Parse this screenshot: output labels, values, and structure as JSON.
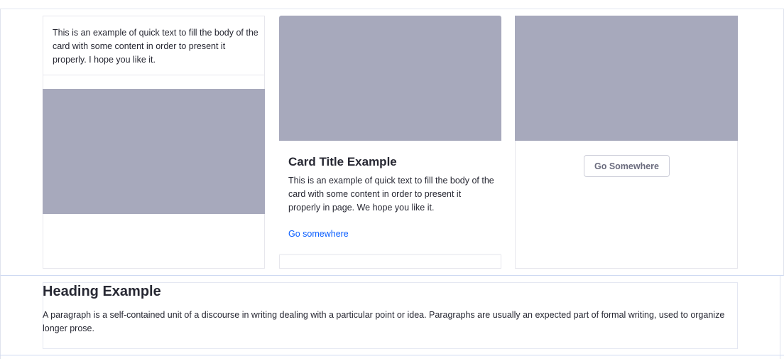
{
  "cards": {
    "card1": {
      "text": "This is an example of quick text to fill the body of the card with some content in order to present it properly. I hope you like it."
    },
    "card2": {
      "title": "Card Title Example",
      "text": "This is an example of quick text to fill the body of the card with some content in order to present it properly in page. We hope you like it.",
      "link": "Go somewhere"
    },
    "card3": {
      "button": "Go Somewhere"
    }
  },
  "section": {
    "heading": "Heading Example",
    "paragraph": "A paragraph is a self-contained unit of a discourse in writing dealing with a particular point or idea. Paragraphs are usually an expected part of formal writing, used to organize longer prose."
  },
  "colors": {
    "image_placeholder": "#a7a9bc",
    "link": "#0b5fff",
    "frame": "#cfdaf2"
  }
}
